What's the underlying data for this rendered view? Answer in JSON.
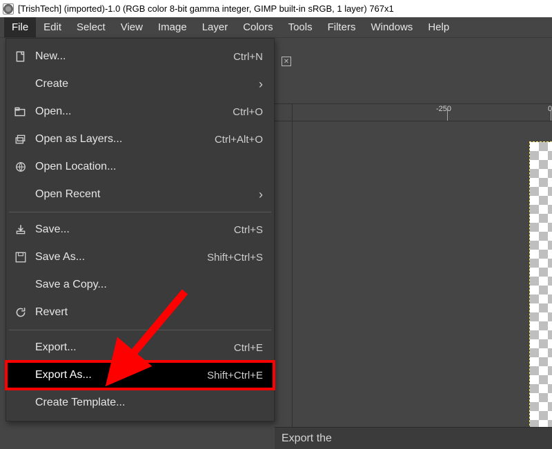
{
  "title": "[TrishTech] (imported)-1.0 (RGB color 8-bit gamma integer, GIMP built-in sRGB, 1 layer) 767x1",
  "menubar": {
    "items": [
      {
        "label": "File",
        "open": true
      },
      {
        "label": "Edit"
      },
      {
        "label": "Select"
      },
      {
        "label": "View"
      },
      {
        "label": "Image"
      },
      {
        "label": "Layer"
      },
      {
        "label": "Colors"
      },
      {
        "label": "Tools"
      },
      {
        "label": "Filters"
      },
      {
        "label": "Windows"
      },
      {
        "label": "Help"
      }
    ]
  },
  "file_menu": {
    "items": [
      {
        "icon": "new-icon",
        "label": "New...",
        "accel": "Ctrl+N"
      },
      {
        "icon": "",
        "label": "Create",
        "submenu": true
      },
      {
        "icon": "open-icon",
        "label": "Open...",
        "accel": "Ctrl+O"
      },
      {
        "icon": "layers-icon",
        "label": "Open as Layers...",
        "accel": "Ctrl+Alt+O"
      },
      {
        "icon": "globe-icon",
        "label": "Open Location..."
      },
      {
        "icon": "",
        "label": "Open Recent",
        "submenu": true
      },
      {
        "sep": true
      },
      {
        "icon": "save-icon",
        "label": "Save...",
        "accel": "Ctrl+S"
      },
      {
        "icon": "saveas-icon",
        "label": "Save As...",
        "accel": "Shift+Ctrl+S"
      },
      {
        "icon": "",
        "label": "Save a Copy..."
      },
      {
        "icon": "revert-icon",
        "label": "Revert"
      },
      {
        "sep": true
      },
      {
        "icon": "",
        "label": "Export...",
        "accel": "Ctrl+E"
      },
      {
        "icon": "",
        "label": "Export As...",
        "accel": "Shift+Ctrl+E",
        "highlight": true
      },
      {
        "icon": "",
        "label": "Create Template..."
      }
    ]
  },
  "ruler": {
    "ticks": [
      {
        "pos": 250,
        "label": "-250"
      },
      {
        "pos": 400,
        "label": "0"
      }
    ]
  },
  "status": {
    "text": "Export the"
  },
  "annotation": {
    "color": "#ff0000"
  }
}
